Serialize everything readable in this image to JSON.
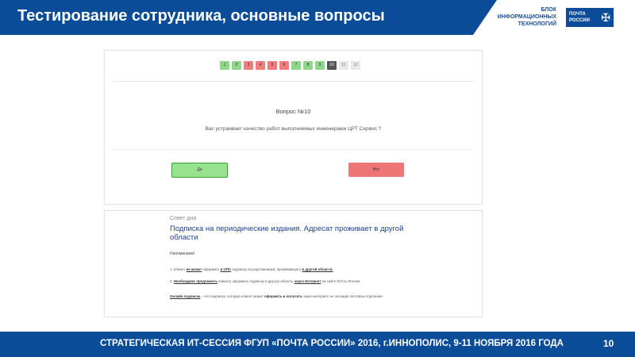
{
  "slide": {
    "title": "Тестирование сотрудника, основные вопросы",
    "block_line1": "БЛОК",
    "block_line2": "ИНФОРМАЦИОННЫХ",
    "block_line3": "ТЕХНОЛОГИЙ",
    "logo_line1": "ПОЧТА",
    "logo_line2": "РОССИИ",
    "footer_text": "СТРАТЕГИЧЕСКАЯ ИТ-СЕССИЯ ФГУП «ПОЧТА РОССИИ» 2016, г.ИННОПОЛИС, 9-11 НОЯБРЯ 2016 ГОДА",
    "page_number": "10"
  },
  "quiz": {
    "pages": [
      {
        "label": "1",
        "status": "green"
      },
      {
        "label": "2",
        "status": "green"
      },
      {
        "label": "3",
        "status": "red"
      },
      {
        "label": "4",
        "status": "red"
      },
      {
        "label": "5",
        "status": "red"
      },
      {
        "label": "6",
        "status": "red"
      },
      {
        "label": "7",
        "status": "green"
      },
      {
        "label": "8",
        "status": "green"
      },
      {
        "label": "9",
        "status": "green"
      },
      {
        "label": "10",
        "status": "active"
      },
      {
        "label": "11",
        "status": "grey"
      },
      {
        "label": "12",
        "status": "grey"
      }
    ],
    "question_number": "Вопрос №10",
    "question_text": "Вас устраивает качество работ выполняемых инженерами ЦРТ Сервис ?",
    "yes_label": "Да",
    "no_label": "Нет"
  },
  "tip": {
    "label": "Совет дня",
    "title": "Подписка на периодические издания. Адресат проживает в другой области",
    "remind": "Напоминаем!",
    "p1": {
      "a": "1. Клиент ",
      "b": "не может",
      "c": " оформить ",
      "d": "в ОПС",
      "e": " подписку на родственника, проживающего ",
      "f": "в другой области."
    },
    "p2": {
      "a": "2. ",
      "b": "Необходимо предложить",
      "c": " клиенту оформить подписку в другую область ",
      "d": "через Интернет",
      "e": " на сайте Почты России."
    },
    "p3": {
      "a": "Онлайн подписка",
      "b": " – это подписка, которую клиент может ",
      "c": "оформить и оплатить",
      "d": " через интернет, не посещая почтовое отделение."
    }
  },
  "colors": {
    "brand_blue": "#0a4c97",
    "answered_green": "#8fd58a",
    "wrong_red": "#ee7e7e",
    "current_dark": "#555555"
  }
}
